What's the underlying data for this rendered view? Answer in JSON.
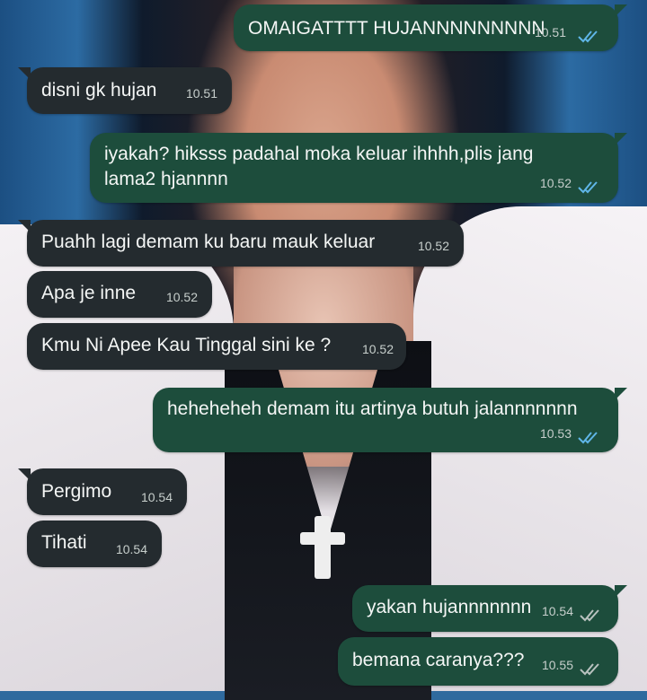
{
  "messages": [
    {
      "dir": "out",
      "text": "OMAIGATTTT HUJANNNNNNNNN",
      "time": "10.51",
      "read": true
    },
    {
      "dir": "in",
      "text": "disni gk hujan",
      "time": "10.51"
    },
    {
      "dir": "out",
      "text": "iyakah? hiksss padahal moka keluar ihhhh,plis jang lama2 hjannnn",
      "time": "10.52",
      "read": true
    },
    {
      "dir": "in",
      "text": "Puahh lagi demam ku baru mauk keluar",
      "time": "10.52"
    },
    {
      "dir": "in",
      "text": "Apa je inne",
      "time": "10.52"
    },
    {
      "dir": "in",
      "text": "Kmu Ni Apee Kau Tinggal sini ke ?",
      "time": "10.52"
    },
    {
      "dir": "out",
      "text": "heheheheh demam itu artinya butuh jalannnnnnn",
      "time": "10.53",
      "read": true
    },
    {
      "dir": "in",
      "text": "Pergimo",
      "time": "10.54"
    },
    {
      "dir": "in",
      "text": "Tihati",
      "time": "10.54"
    },
    {
      "dir": "out",
      "text": "yakan hujannnnnnn",
      "time": "10.54",
      "read": false
    },
    {
      "dir": "out",
      "text": "bemana caranya???",
      "time": "10.55",
      "read": false
    }
  ],
  "colors": {
    "incoming_bubble": "#242b2f",
    "outgoing_bubble": "#1d4d3c",
    "read_check": "#5fb6e8",
    "delivered_check": "#b9c2bf"
  }
}
